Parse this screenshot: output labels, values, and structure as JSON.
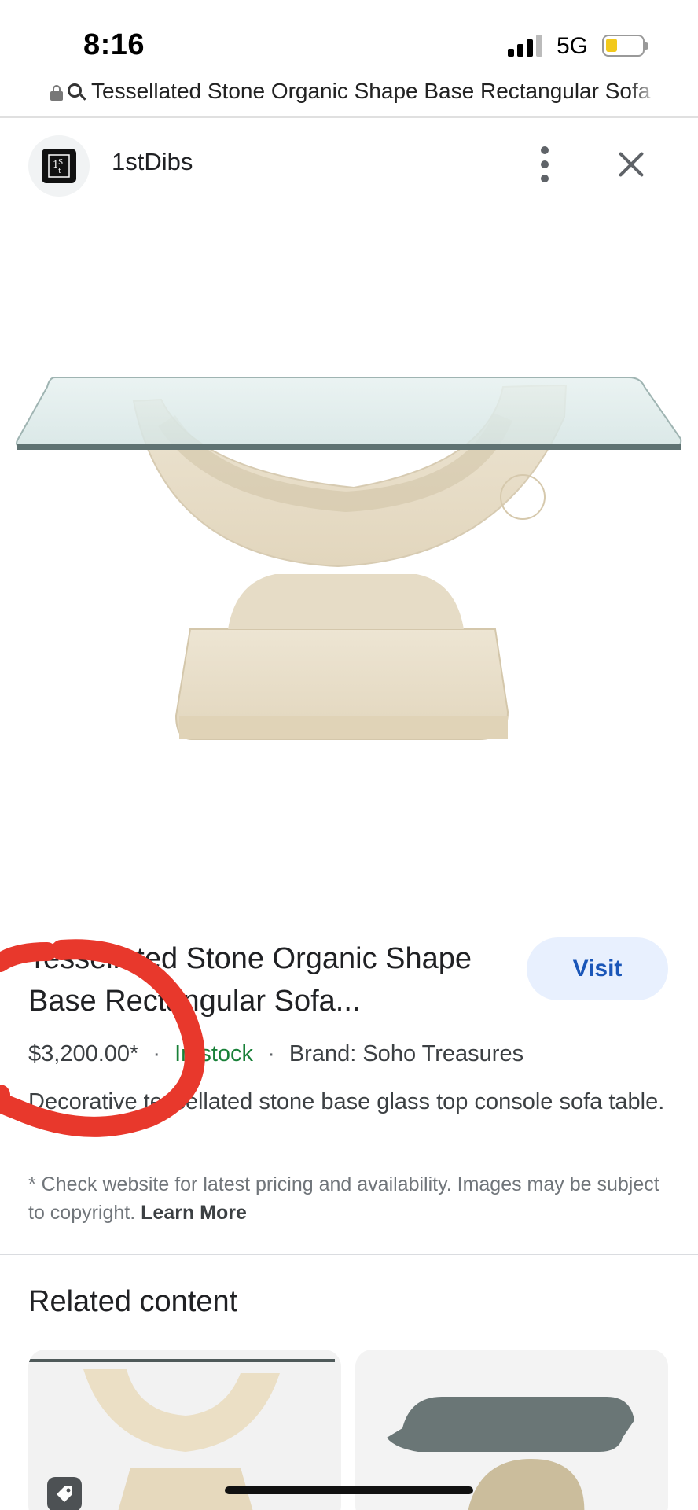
{
  "status_bar": {
    "time": "8:16",
    "network": "5G",
    "battery_color": "#f2c91c"
  },
  "browser": {
    "url_text": "Tessellated Stone Organic Shape Base Rectangular Sofa"
  },
  "site": {
    "logo_text": "1St D",
    "name": "1stDibs",
    "menu_icon": "more-vert-icon",
    "close_icon": "close-icon"
  },
  "product": {
    "title": "Tessellated Stone Organic Shape Base Rectangular Sofa...",
    "visit_label": "Visit",
    "price": "$3,200.00*",
    "separator": "·",
    "stock": "In stock",
    "brand": "Brand: Soho Treasures",
    "description": "Decorative tessellated stone base glass top console sofa table.",
    "disclaimer": "* Check website for latest pricing and availability. Images may be subject to copyright.",
    "learn_more": "Learn More"
  },
  "related": {
    "title": "Related content"
  },
  "colors": {
    "accent_blue": "#1a56b8",
    "stock_green": "#188038",
    "annotation_red": "#e8382c"
  }
}
